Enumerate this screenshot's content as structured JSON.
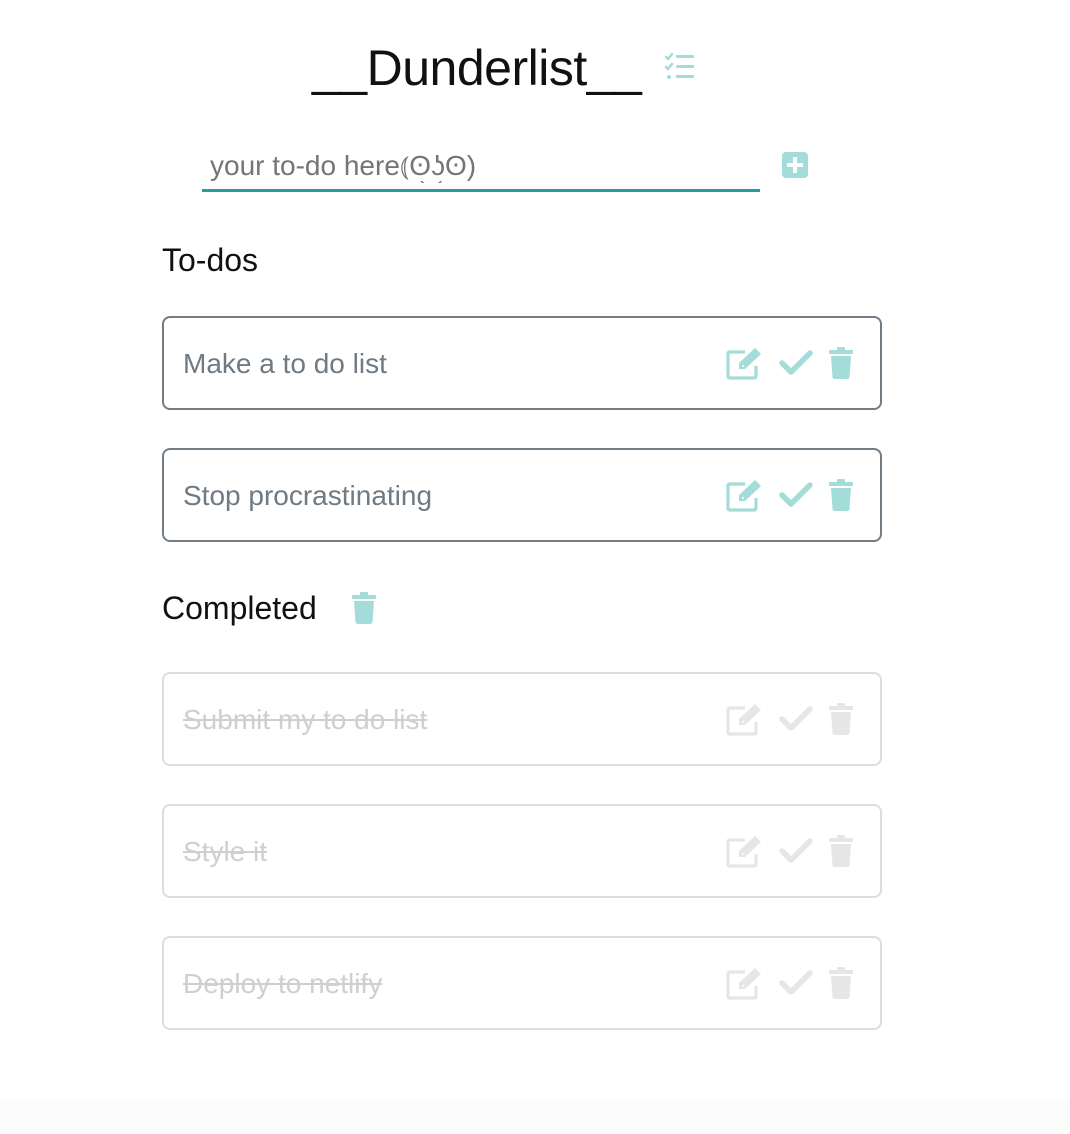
{
  "app": {
    "title": "__Dunderlist__",
    "title_icon": "task-list-icon"
  },
  "input": {
    "placeholder": "your to-do here⦅ʘ͜ʖʘ)",
    "add_icon": "plus-square-icon"
  },
  "sections": {
    "todos_heading": "To-dos",
    "completed_heading": "Completed",
    "clear_icon": "trash-icon"
  },
  "todos": [
    {
      "text": "Make a to do list",
      "completed": false
    },
    {
      "text": "Stop procrastinating",
      "completed": false
    }
  ],
  "completed": [
    {
      "text": "Submit my to do list",
      "completed": true
    },
    {
      "text": "Style it",
      "completed": true
    },
    {
      "text": "Deploy to netlify",
      "completed": true
    }
  ],
  "icons": {
    "edit": "edit-icon",
    "check": "check-icon",
    "delete": "trash-icon"
  },
  "colors": {
    "accent": "#2a9d98",
    "icon_active": "#a3dcd8",
    "icon_done": "#e6e6e6",
    "text_active": "#6f7a83",
    "text_done": "#cfcfcf",
    "border_active": "#727c84",
    "border_done": "#dddddd"
  }
}
